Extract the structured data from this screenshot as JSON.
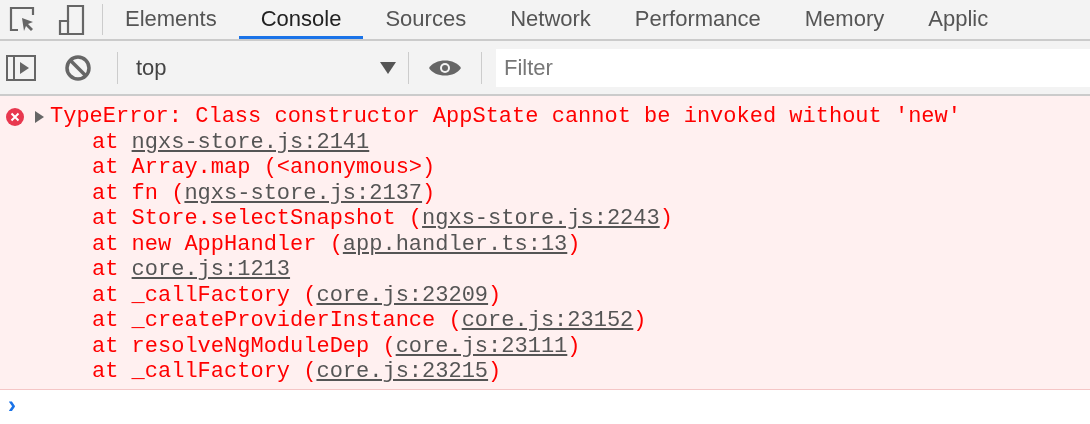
{
  "tabs": [
    {
      "label": "Elements",
      "selected": false
    },
    {
      "label": "Console",
      "selected": true
    },
    {
      "label": "Sources",
      "selected": false
    },
    {
      "label": "Network",
      "selected": false
    },
    {
      "label": "Performance",
      "selected": false
    },
    {
      "label": "Memory",
      "selected": false
    },
    {
      "label": "Applic",
      "selected": false
    }
  ],
  "toolbar": {
    "context": "top",
    "filter": {
      "placeholder": "Filter"
    }
  },
  "messages": [
    {
      "kind": "error",
      "expanded": false,
      "text": "TypeError: Class constructor AppState cannot be invoked without 'new'",
      "stack": [
        {
          "prefix": "at ",
          "link": "ngxs-store.js:2141"
        },
        {
          "prefix": "at Array.map (<anonymous>)"
        },
        {
          "prefix": "at fn (",
          "link": "ngxs-store.js:2137",
          "suffix": ")"
        },
        {
          "prefix": "at Store.selectSnapshot (",
          "link": "ngxs-store.js:2243",
          "suffix": ")"
        },
        {
          "prefix": "at new AppHandler (",
          "link": "app.handler.ts:13",
          "suffix": ")"
        },
        {
          "prefix": "at ",
          "link": "core.js:1213"
        },
        {
          "prefix": "at _callFactory (",
          "link": "core.js:23209",
          "suffix": ")"
        },
        {
          "prefix": "at _createProviderInstance (",
          "link": "core.js:23152",
          "suffix": ")"
        },
        {
          "prefix": "at resolveNgModuleDep (",
          "link": "core.js:23111",
          "suffix": ")"
        },
        {
          "prefix": "at _callFactory (",
          "link": "core.js:23215",
          "suffix": ")"
        }
      ]
    }
  ],
  "prompt": {
    "symbol": "›"
  }
}
